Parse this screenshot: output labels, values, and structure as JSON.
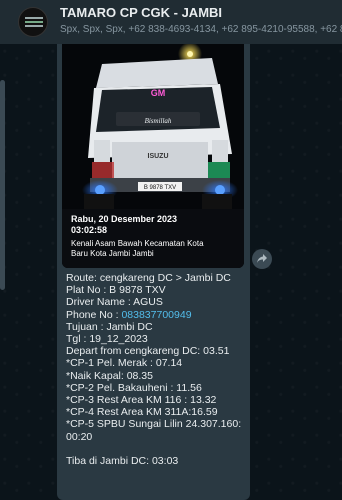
{
  "header": {
    "title": "TAMARO CP CGK - JAMBI",
    "subtitle": "Spx, Spx, Spx, +62 838-4693-4134, +62 895-4210-95588, +62 85"
  },
  "photo": {
    "icon": "truck-photo",
    "stamp_date": "Rabu, 20 Desember 2023",
    "stamp_time": "03:02:58",
    "stamp_loc1": "Kenali Asam Bawah Kecamatan Kota",
    "stamp_loc2": "Baru Kota Jambi Jambi",
    "windshield_text": "GM",
    "visor_text": "Bismillah",
    "brand_text": "ISUZU",
    "plate_text": "B 9878 TXV"
  },
  "message": {
    "route": "Route: cengkareng DC > Jambi DC",
    "plat": "Plat No : B 9878 TXV",
    "driver": "Driver Name : AGUS",
    "phone_label": "Phone No : ",
    "phone_number": "083837700949",
    "tujuan": "Tujuan : Jambi DC",
    "tgl": "Tgl : 19_12_2023",
    "depart": "Depart from cengkareng DC:  03.51",
    "cp1": "*CP-1 Pel. Merak : 07.14",
    "naik": "*Naik Kapal: 08.35",
    "cp2": "*CP-2 Pel. Bakauheni : 11.56",
    "cp3": "*CP-3 Rest Area KM 116 : 13.32",
    "cp4": "*CP-4 Rest Area KM 311A:16.59",
    "cp5a": "*CP-5 SPBU Sungai Lilin 24.307.160:",
    "cp5b": "00:20",
    "tiba": "Tiba di Jambi DC: 03:03"
  },
  "icons": {
    "share": "share-arrow-icon"
  }
}
